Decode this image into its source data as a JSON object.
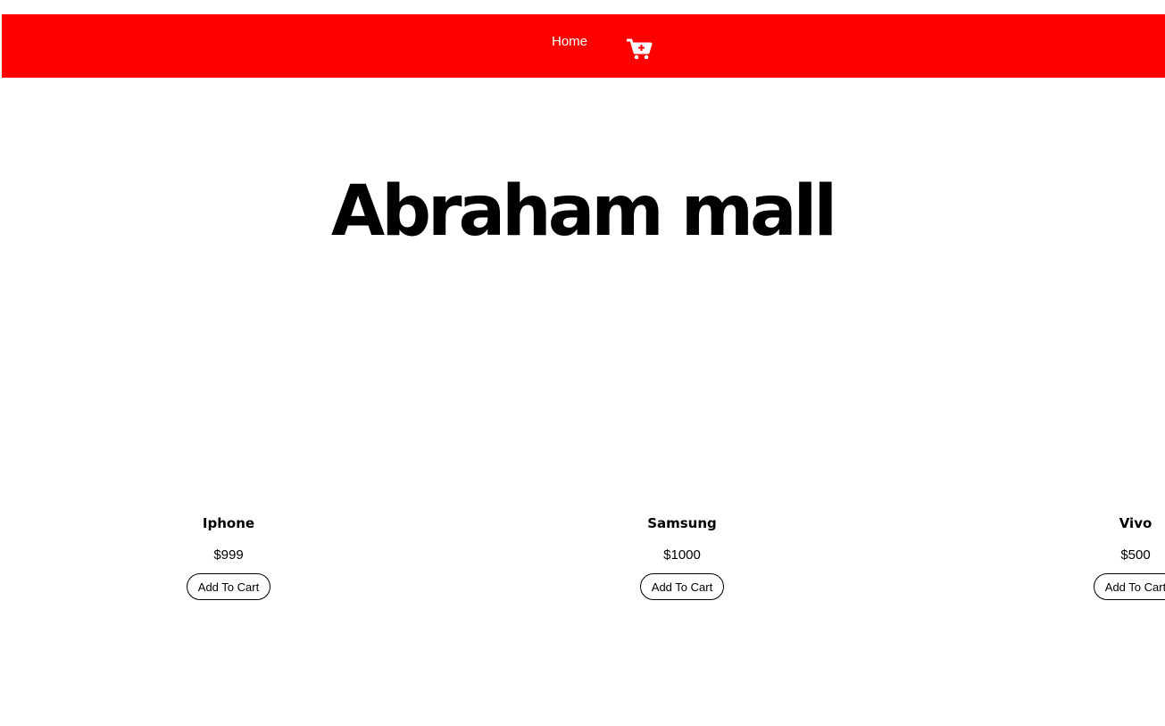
{
  "navbar": {
    "home_label": "Home",
    "cart_icon": "cart-plus-icon",
    "background": "#ff0000"
  },
  "hero": {
    "title": "Abraham mall"
  },
  "products": [
    {
      "name": "Iphone",
      "price": "$999",
      "button_label": "Add To Cart"
    },
    {
      "name": "Samsung",
      "price": "$1000",
      "button_label": "Add To Cart"
    },
    {
      "name": "Vivo",
      "price": "$500",
      "button_label": "Add To Cart"
    }
  ]
}
